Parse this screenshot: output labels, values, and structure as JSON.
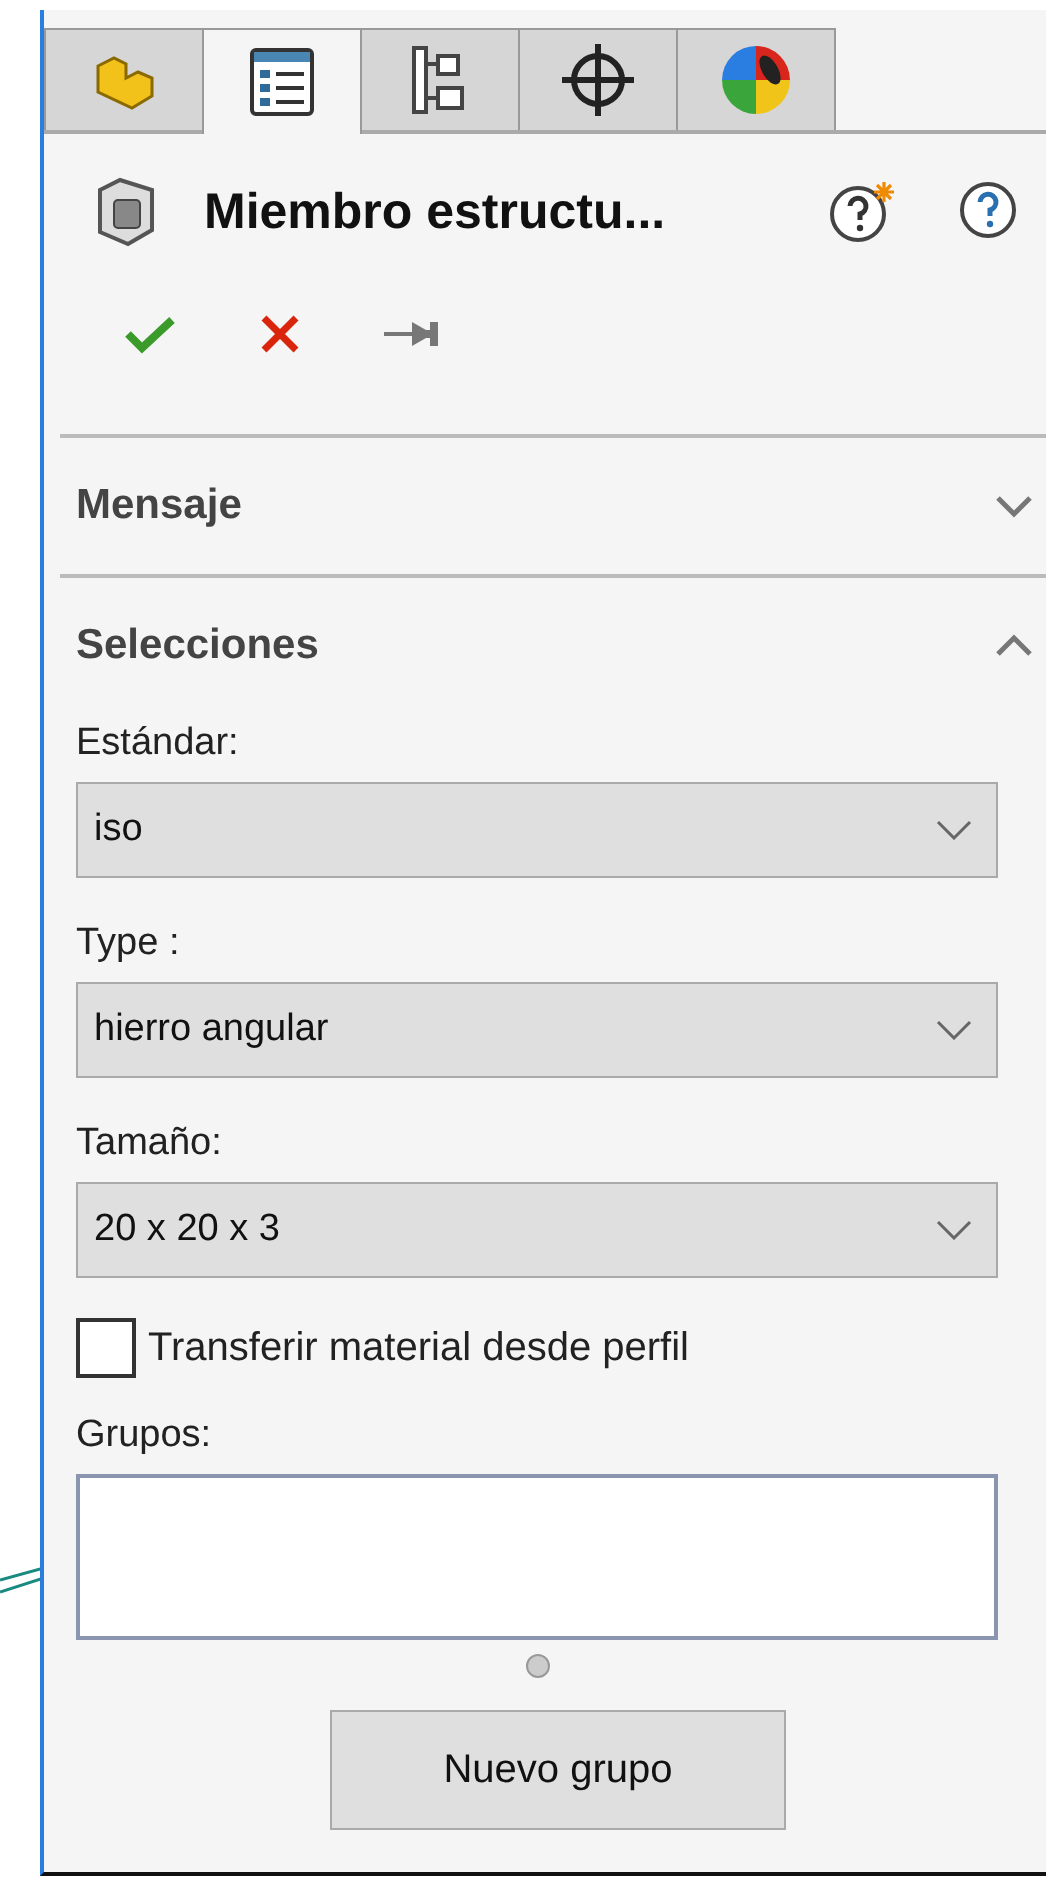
{
  "tabs": [
    {
      "kind": "part",
      "selected": false
    },
    {
      "kind": "properties",
      "selected": true
    },
    {
      "kind": "configurations",
      "selected": false
    },
    {
      "kind": "origin",
      "selected": false
    },
    {
      "kind": "appearance",
      "selected": false
    }
  ],
  "title": "Miembro estructu...",
  "sections": [
    {
      "title": "Mensaje",
      "expanded": false
    },
    {
      "title": "Selecciones",
      "expanded": true,
      "fields": [
        {
          "kind": "dropdown",
          "label": "Estándar:",
          "value": "iso"
        },
        {
          "kind": "dropdown",
          "label": "Type :",
          "value": "hierro angular"
        },
        {
          "kind": "dropdown",
          "label": "Tamaño:",
          "value": "20 x 20 x 3"
        },
        {
          "kind": "checkbox",
          "label": "Transferir material desde perfil",
          "checked": false
        },
        {
          "kind": "list",
          "label": "Grupos:"
        },
        {
          "kind": "button",
          "label": "Nuevo grupo"
        }
      ]
    }
  ]
}
